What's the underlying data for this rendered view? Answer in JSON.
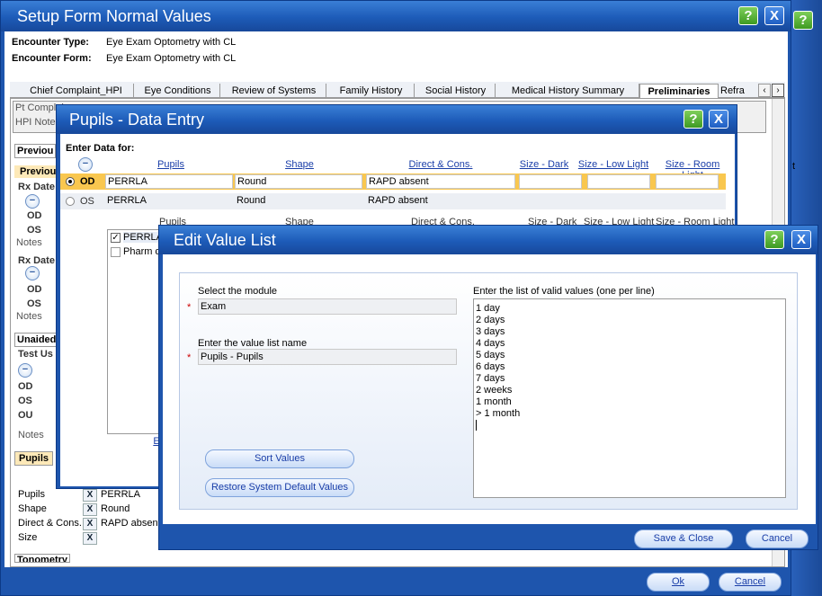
{
  "setup": {
    "title": "Setup Form Normal Values",
    "encounter_type_label": "Encounter Type:",
    "encounter_type": "Eye Exam Optometry with CL",
    "encounter_form_label": "Encounter Form:",
    "encounter_form": "Eye Exam Optometry with CL",
    "tabs": [
      "Chief Complaint_HPI",
      "Eye Conditions",
      "Review of Systems",
      "Family History",
      "Social History",
      "Medical History Summary",
      "Preliminaries",
      "Refra"
    ],
    "pt_complaint": "Pt Complai",
    "hpi_notes": "HPI Note",
    "previous_1": "Previou",
    "previous_2": "Previou",
    "rx_date_1": "Rx Date",
    "rx_date_2": "Rx Date",
    "od": "OD",
    "os": "OS",
    "ou": "OU",
    "notes": "Notes",
    "unaided": "Unaided",
    "test_used": "Test Us",
    "pupils_section": "Pupils",
    "pupils_rows": [
      {
        "label": "Pupils",
        "value": "PERRLA"
      },
      {
        "label": "Shape",
        "value": "Round"
      },
      {
        "label": "Direct & Cons.",
        "value": "RAPD absent"
      },
      {
        "label": "Size",
        "value": ""
      }
    ],
    "tonometry": "Tonometry",
    "side_t": "t",
    "ok": "Ok",
    "cancel": "Cancel"
  },
  "pupils_entry": {
    "title": "Pupils - Data Entry",
    "enter_data_for": "Enter Data for:",
    "columns": [
      "Pupils",
      "Shape",
      "Direct & Cons.",
      "Size - Dark",
      "Size - Low Light",
      "Size - Room Light"
    ],
    "rows": [
      {
        "eye": "OD",
        "pupils": "PERRLA",
        "shape": "Round",
        "direct": "RAPD absent"
      },
      {
        "eye": "OS",
        "pupils": "PERRLA",
        "shape": "Round",
        "direct": "RAPD absent"
      }
    ],
    "list_items": [
      "PERRLA",
      "Pharm d"
    ],
    "link_e": "E"
  },
  "edit_value_list": {
    "title": "Edit Value List",
    "select_module_label": "Select the module",
    "module_value": "Exam",
    "value_list_name_label": "Enter the value list name",
    "value_list_name": "Pupils - Pupils",
    "valid_values_label": "Enter the list of valid values (one per line)",
    "values": [
      "1 day",
      "2 days",
      "3 days",
      "4 days",
      "5 days",
      "6 days",
      "7 days",
      "2 weeks",
      "1 month",
      "> 1 month"
    ],
    "sort_values": "Sort Values",
    "restore_defaults": "Restore System Default Values",
    "save_close": "Save & Close",
    "cancel": "Cancel"
  },
  "icons": {
    "help": "?",
    "close": "X",
    "check": "✓",
    "minus": "−"
  },
  "colors": {
    "title_blue": "#1d5bb8",
    "help_green": "#3e9a22",
    "selected_row": "#f9c74f"
  }
}
